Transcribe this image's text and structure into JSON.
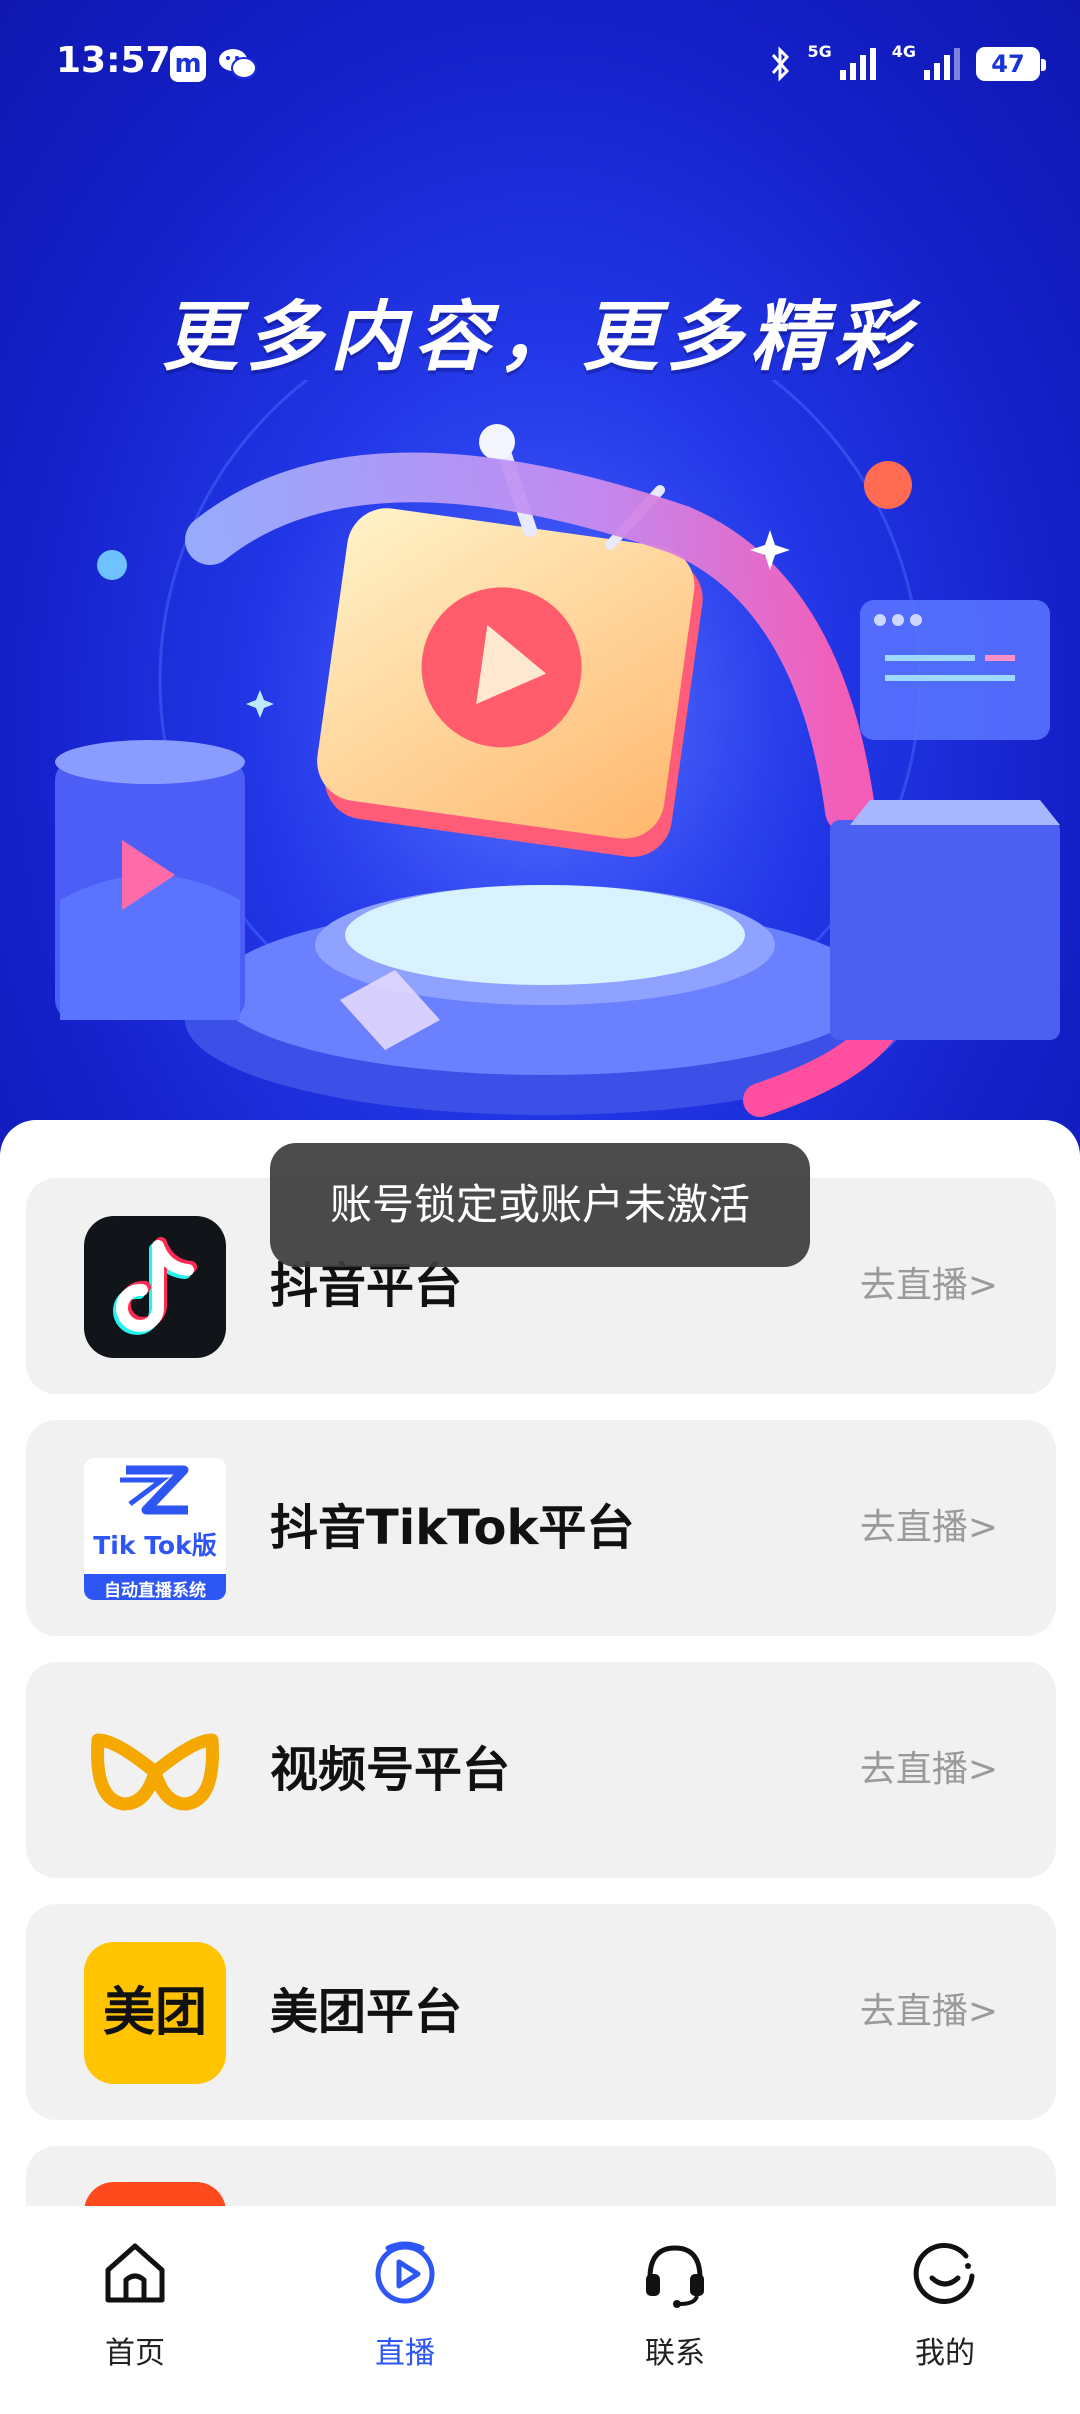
{
  "status_bar": {
    "time": "13:57",
    "app_badge_letter": "m",
    "net_1": "5G",
    "net_2": "4G",
    "battery": "47"
  },
  "banner": {
    "title": "更多内容，更多精彩"
  },
  "toast": {
    "text": "账号锁定或账户未激活"
  },
  "platforms": [
    {
      "name": "抖音平台",
      "action": "去直播>",
      "icon": "douyin-icon"
    },
    {
      "name": "抖音TikTok平台",
      "action": "去直播>",
      "icon": "tiktok-live-icon",
      "icon_text": "Tik Tok版",
      "icon_sub": "自动直播系统"
    },
    {
      "name": "视频号平台",
      "action": "去直播>",
      "icon": "channels-icon"
    },
    {
      "name": "美团平台",
      "action": "去直播>",
      "icon": "meituan-icon",
      "icon_text": "美团"
    }
  ],
  "nav": [
    {
      "label": "首页",
      "icon": "home-icon"
    },
    {
      "label": "直播",
      "icon": "live-icon",
      "active": true
    },
    {
      "label": "联系",
      "icon": "headset-icon"
    },
    {
      "label": "我的",
      "icon": "profile-icon"
    }
  ],
  "colors": {
    "banner_blue": "#1420c8",
    "accent": "#2d56f5",
    "meituan_yellow": "#ffc300",
    "channels_orange": "#f5a800",
    "action_gray": "#9a9a9a"
  }
}
